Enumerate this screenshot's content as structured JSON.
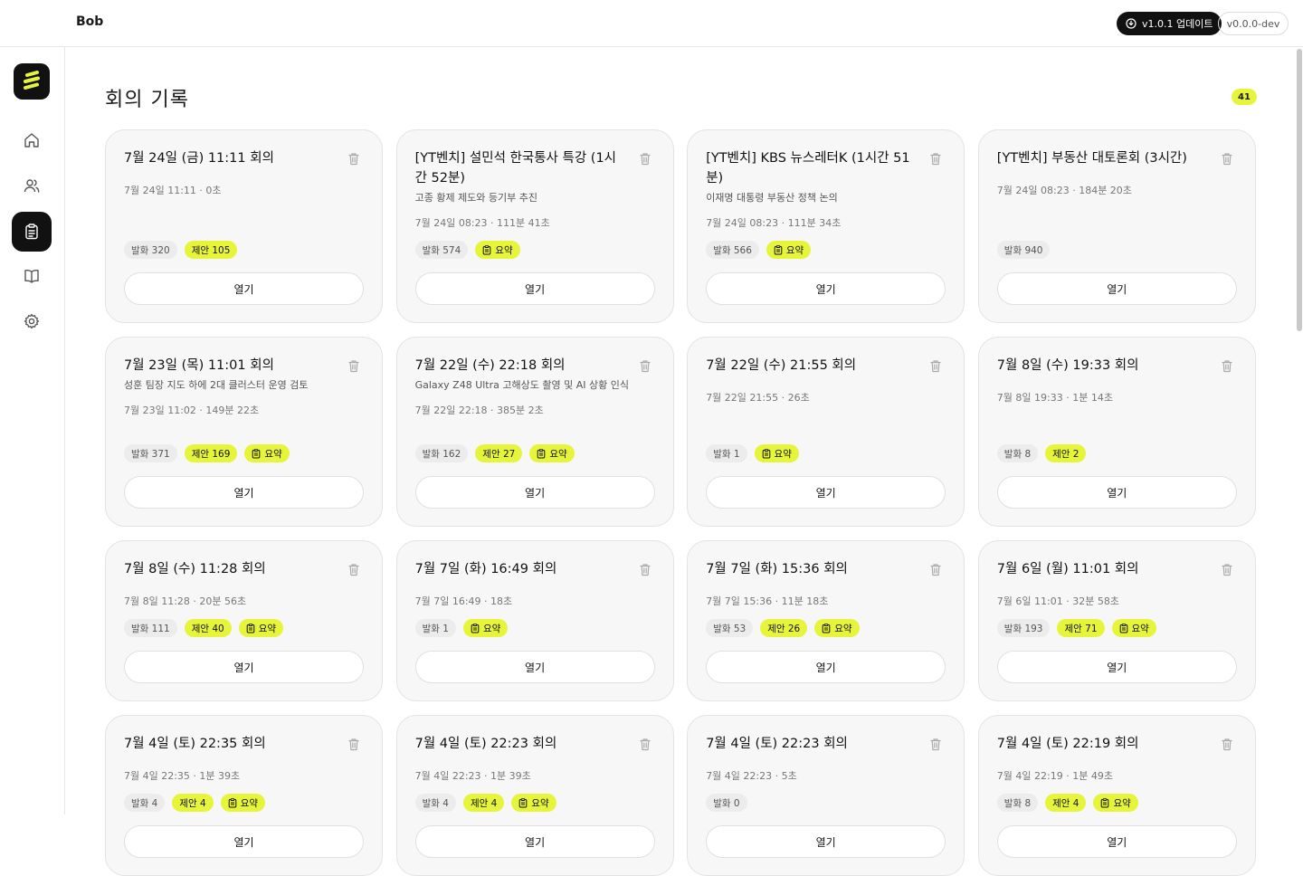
{
  "topbar": {
    "app_name": "Bob",
    "update_label": "v1.0.1 업데이트",
    "version_label": "v0.0.0-dev"
  },
  "sidebar": {
    "items": [
      {
        "name": "home",
        "icon": "home-icon"
      },
      {
        "name": "people",
        "icon": "users-icon"
      },
      {
        "name": "meetings",
        "icon": "clipboard-icon",
        "active": true
      },
      {
        "name": "library",
        "icon": "book-icon"
      },
      {
        "name": "settings",
        "icon": "gear-icon"
      }
    ]
  },
  "main": {
    "title": "회의 기록",
    "count": "41",
    "open_label": "열기",
    "summary_label": "요약",
    "utterance_prefix": "발화",
    "proposal_prefix": "제안",
    "cards": [
      {
        "title": "7월 24일 (금) 11:11 회의",
        "subtitle": "",
        "meta": "7월 24일 11:11 · 0초",
        "utterances": "발화 320",
        "proposals": "제안 105",
        "summary": false
      },
      {
        "title": "[YT벤치] 설민석 한국통사 특강 (1시간 52분)",
        "subtitle": "고종 황제 제도와 등기부 추진",
        "meta": "7월 24일 08:23 · 111분 41초",
        "utterances": "발화 574",
        "proposals": "",
        "summary": true
      },
      {
        "title": "[YT벤치] KBS 뉴스레터K (1시간 51분)",
        "subtitle": "이재명 대통령 부동산 정책 논의",
        "meta": "7월 24일 08:23 · 111분 34초",
        "utterances": "발화 566",
        "proposals": "",
        "summary": true
      },
      {
        "title": "[YT벤치] 부동산 대토론회 (3시간)",
        "subtitle": "",
        "meta": "7월 24일 08:23 · 184분 20초",
        "utterances": "발화 940",
        "proposals": "",
        "summary": false
      },
      {
        "title": "7월 23일 (목) 11:01 회의",
        "subtitle": "성훈 팀장 지도 하에 2대 클러스터 운영 검토",
        "meta": "7월 23일 11:02 · 149분 22초",
        "utterances": "발화 371",
        "proposals": "제안 169",
        "summary": true
      },
      {
        "title": "7월 22일 (수) 22:18 회의",
        "subtitle": "Galaxy Z48 Ultra 고해상도 촬영 및 AI 상황 인식",
        "meta": "7월 22일 22:18 · 385분 2초",
        "utterances": "발화 162",
        "proposals": "제안 27",
        "summary": true
      },
      {
        "title": "7월 22일 (수) 21:55 회의",
        "subtitle": "",
        "meta": "7월 22일 21:55 · 26초",
        "utterances": "발화 1",
        "proposals": "",
        "summary": true
      },
      {
        "title": "7월 8일 (수) 19:33 회의",
        "subtitle": "",
        "meta": "7월 8일 19:33 · 1분 14초",
        "utterances": "발화 8",
        "proposals": "제안 2",
        "summary": false
      },
      {
        "title": "7월 8일 (수) 11:28 회의",
        "subtitle": "",
        "meta": "7월 8일 11:28 · 20분 56초",
        "utterances": "발화 111",
        "proposals": "제안 40",
        "summary": true
      },
      {
        "title": "7월 7일 (화) 16:49 회의",
        "subtitle": "",
        "meta": "7월 7일 16:49 · 18초",
        "utterances": "발화 1",
        "proposals": "",
        "summary": true
      },
      {
        "title": "7월 7일 (화) 15:36 회의",
        "subtitle": "",
        "meta": "7월 7일 15:36 · 11분 18초",
        "utterances": "발화 53",
        "proposals": "제안 26",
        "summary": true
      },
      {
        "title": "7월 6일 (월) 11:01 회의",
        "subtitle": "",
        "meta": "7월 6일 11:01 · 32분 58초",
        "utterances": "발화 193",
        "proposals": "제안 71",
        "summary": true
      },
      {
        "title": "7월 4일 (토) 22:35 회의",
        "subtitle": "",
        "meta": "7월 4일 22:35 · 1분 39초",
        "utterances": "발화 4",
        "proposals": "제안 4",
        "summary": true
      },
      {
        "title": "7월 4일 (토) 22:23 회의",
        "subtitle": "",
        "meta": "7월 4일 22:23 · 1분 39초",
        "utterances": "발화 4",
        "proposals": "제안 4",
        "summary": true
      },
      {
        "title": "7월 4일 (토) 22:23 회의",
        "subtitle": "",
        "meta": "7월 4일 22:23 · 5초",
        "utterances": "발화 0",
        "proposals": "",
        "summary": false
      },
      {
        "title": "7월 4일 (토) 22:19 회의",
        "subtitle": "",
        "meta": "7월 4일 22:19 · 1분 49초",
        "utterances": "발화 8",
        "proposals": "제안 4",
        "summary": true
      }
    ]
  },
  "colors": {
    "accent": "#e6f53a",
    "dark": "#111111"
  }
}
